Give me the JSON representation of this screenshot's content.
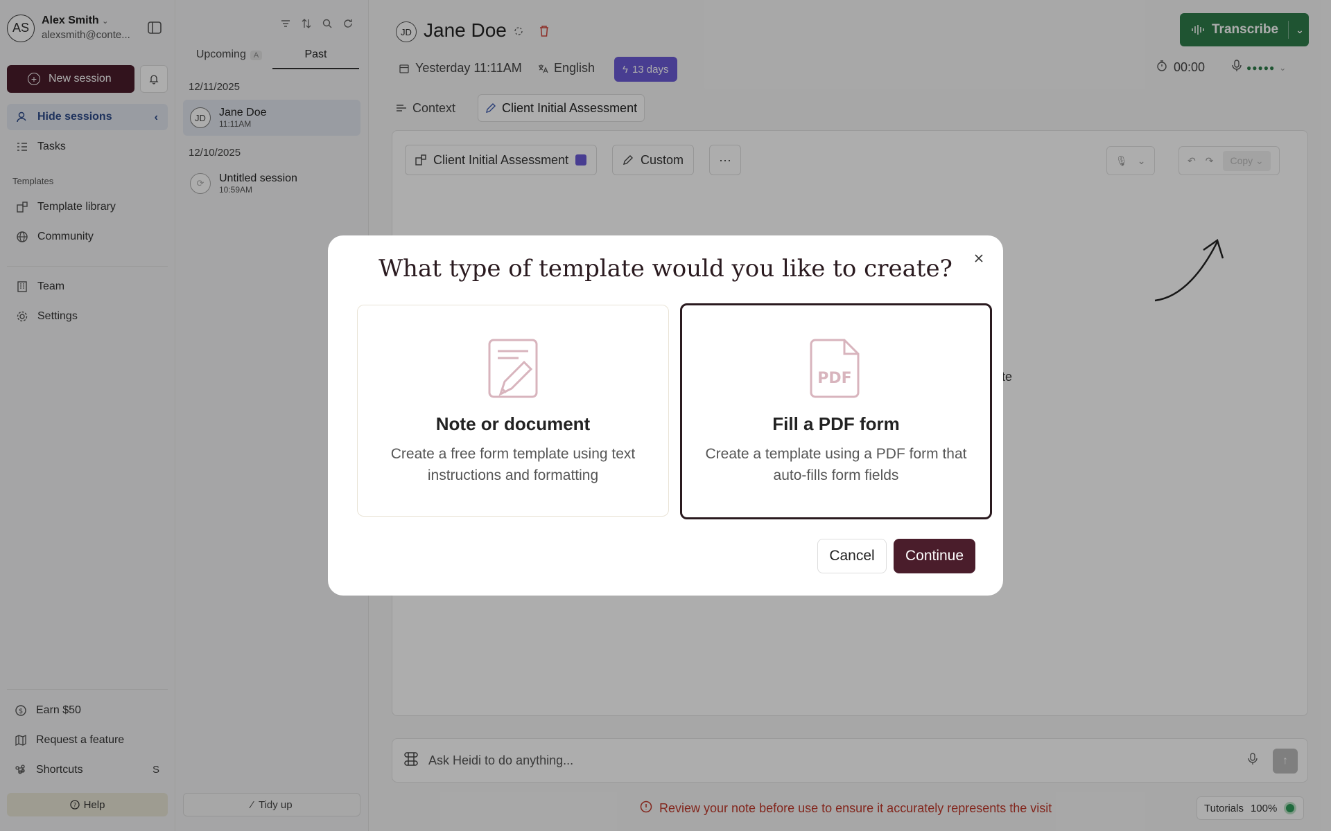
{
  "user": {
    "initials": "AS",
    "name": "Alex Smith",
    "email": "alexsmith@conte..."
  },
  "sidebar": {
    "new_session": "New session",
    "hide_sessions": "Hide sessions",
    "tasks": "Tasks",
    "templates_label": "Templates",
    "template_library": "Template library",
    "community": "Community",
    "team": "Team",
    "settings": "Settings",
    "earn": "Earn $50",
    "request_feature": "Request a feature",
    "shortcuts": "Shortcuts",
    "shortcuts_key": "S",
    "help": "Help"
  },
  "sessions": {
    "tabs": [
      {
        "label": "Upcoming",
        "badge": "A"
      },
      {
        "label": "Past"
      }
    ],
    "groups": [
      {
        "date": "12/11/2025",
        "items": [
          {
            "initials": "JD",
            "name": "Jane Doe",
            "time": "11:11AM"
          }
        ]
      },
      {
        "date": "12/10/2025",
        "items": [
          {
            "name": "Untitled session",
            "time": "10:59AM"
          }
        ]
      }
    ],
    "tidy_up": "Tidy up"
  },
  "header": {
    "initials": "JD",
    "name": "Jane Doe",
    "transcribe": "Transcribe",
    "date": "Yesterday 11:11AM",
    "language": "English",
    "days": "13 days",
    "timer": "00:00"
  },
  "tabs": {
    "context": "Context",
    "template": "Client Initial Assessment"
  },
  "toolbar": {
    "template": "Client Initial Assessment",
    "custom": "Custom",
    "more": "···",
    "copy": "Copy"
  },
  "note": {
    "partial_text": "te"
  },
  "chat": {
    "placeholder": "Ask Heidi to do anything..."
  },
  "footer": {
    "warning": "Review your note before use to ensure it accurately represents the visit",
    "tutorials": "Tutorials",
    "zoom": "100%"
  },
  "modal": {
    "title": "What type of template would you like to create?",
    "options": [
      {
        "title": "Note or document",
        "description": "Create a free form template using text instructions and formatting"
      },
      {
        "title": "Fill a PDF form",
        "description": "Create a template using a PDF form that auto-fills form fields",
        "selected": true
      }
    ],
    "cancel": "Cancel",
    "continue": "Continue"
  },
  "colors": {
    "brand": "#4a1d2b",
    "transcribe": "#2e7d4a",
    "accent": "#6b5ad6",
    "warning": "#c0392b"
  }
}
